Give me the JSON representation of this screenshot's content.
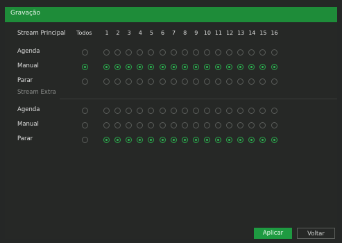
{
  "window": {
    "title": "Gravação"
  },
  "main_section": {
    "label": "Stream Principal"
  },
  "extra_section": {
    "label": "Stream Extra"
  },
  "columns": {
    "all_label": "Todos",
    "channels": [
      "1",
      "2",
      "3",
      "4",
      "5",
      "6",
      "7",
      "8",
      "9",
      "10",
      "11",
      "12",
      "13",
      "14",
      "15",
      "16"
    ]
  },
  "rows": [
    {
      "label": "Agenda",
      "all": false,
      "channels": [
        0,
        0,
        0,
        0,
        0,
        0,
        0,
        0,
        0,
        0,
        0,
        0,
        0,
        0,
        0,
        0
      ]
    },
    {
      "label": "Manual",
      "all": true,
      "channels": [
        1,
        1,
        1,
        1,
        1,
        1,
        1,
        1,
        1,
        1,
        1,
        1,
        1,
        1,
        1,
        1
      ]
    },
    {
      "label": "Parar",
      "all": false,
      "channels": [
        0,
        0,
        0,
        0,
        0,
        0,
        0,
        0,
        0,
        0,
        0,
        0,
        0,
        0,
        0,
        0
      ]
    },
    {
      "label": "Agenda",
      "all": false,
      "channels": [
        0,
        0,
        0,
        0,
        0,
        0,
        0,
        0,
        0,
        0,
        0,
        0,
        0,
        0,
        0,
        0
      ]
    },
    {
      "label": "Manual",
      "all": false,
      "channels": [
        0,
        0,
        0,
        0,
        0,
        0,
        0,
        0,
        0,
        0,
        0,
        0,
        0,
        0,
        0,
        0
      ]
    },
    {
      "label": "Parar",
      "all": false,
      "channels": [
        1,
        1,
        1,
        1,
        1,
        1,
        1,
        1,
        1,
        1,
        1,
        1,
        1,
        1,
        1,
        1
      ]
    }
  ],
  "buttons": {
    "apply": "Aplicar",
    "back": "Voltar"
  },
  "colors": {
    "accent": "#1e8c39",
    "selected": "#2dbb55",
    "background": "#252726"
  }
}
